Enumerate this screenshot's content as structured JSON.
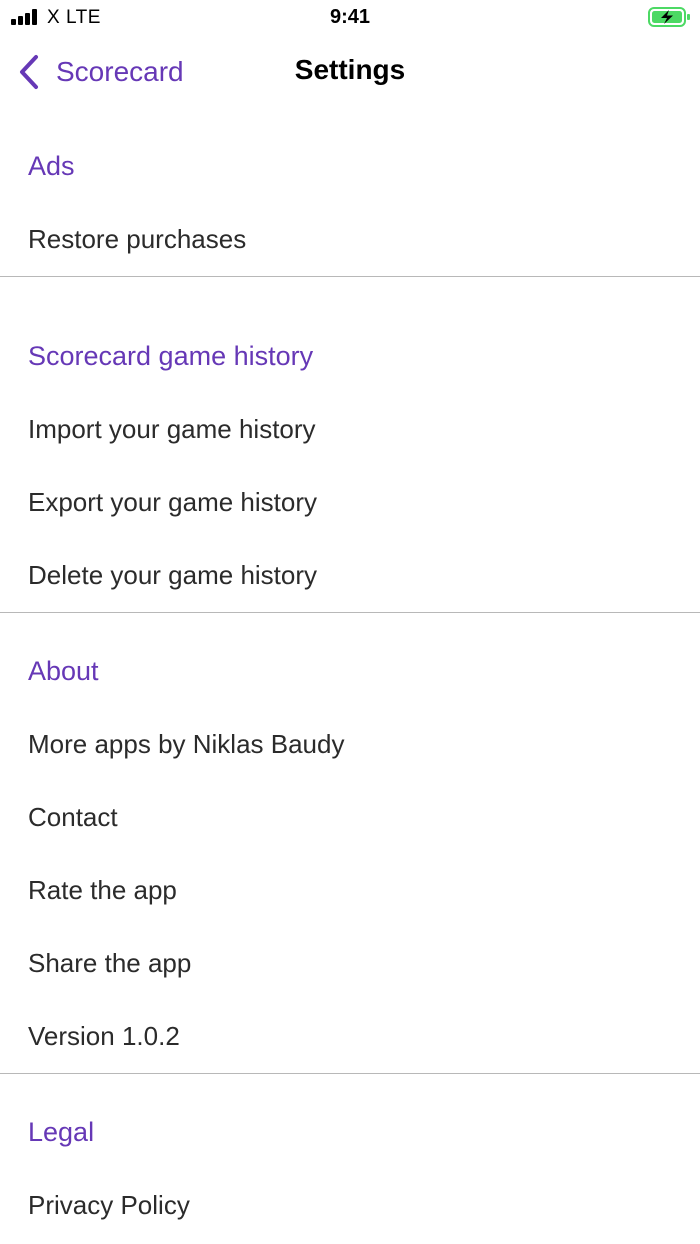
{
  "status_bar": {
    "carrier": "X  LTE",
    "time": "9:41",
    "battery_color": "#4cd964"
  },
  "nav": {
    "back_label": "Scorecard",
    "title": "Settings",
    "accent_color": "#6638b6"
  },
  "sections": [
    {
      "header": "Ads",
      "items": [
        "Restore purchases"
      ]
    },
    {
      "header": "Scorecard game history",
      "items": [
        "Import your game history",
        "Export your game history",
        "Delete your game history"
      ]
    },
    {
      "header": "About",
      "items": [
        "More apps by Niklas Baudy",
        "Contact",
        "Rate the app",
        "Share the app",
        "Version 1.0.2"
      ]
    },
    {
      "header": "Legal",
      "items": [
        "Privacy Policy"
      ]
    }
  ]
}
